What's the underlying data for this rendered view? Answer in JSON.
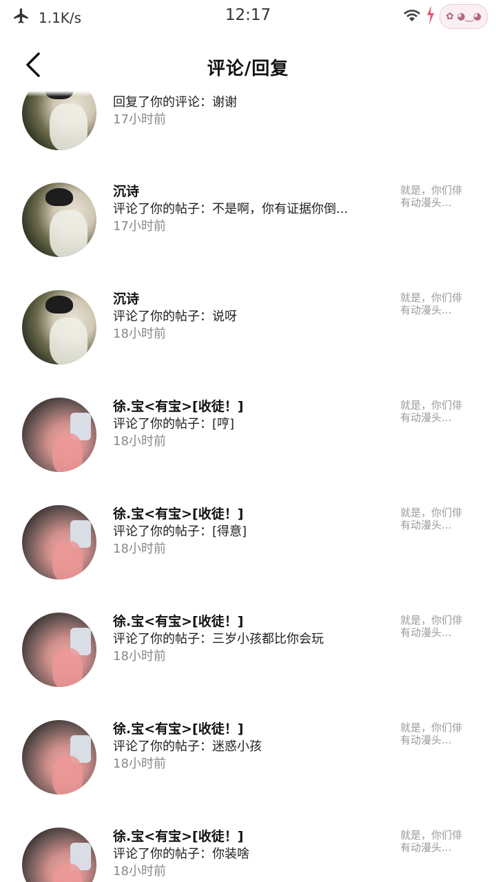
{
  "status_bar": {
    "network_speed": "1.1K/s",
    "time": "12:17"
  },
  "header": {
    "title": "评论/回复"
  },
  "items": [
    {
      "name": "",
      "action": "回复了你的评论：谢谢",
      "time": "17小时前",
      "preview": [
        "",
        ""
      ],
      "avatar": "a"
    },
    {
      "name": "沉诗",
      "action": "评论了你的帖子：不是啊，你有证据你倒...",
      "time": "17小时前",
      "preview": [
        "就是，你们俳",
        "有动漫头..."
      ],
      "avatar": "a"
    },
    {
      "name": "沉诗",
      "action": "评论了你的帖子：说呀",
      "time": "18小时前",
      "preview": [
        "就是，你们俳",
        "有动漫头..."
      ],
      "avatar": "a"
    },
    {
      "name": "徐.宝<有宝>[收徒！]",
      "action": "评论了你的帖子：[哼]",
      "time": "18小时前",
      "preview": [
        "就是，你们俳",
        "有动漫头..."
      ],
      "avatar": "b"
    },
    {
      "name": "徐.宝<有宝>[收徒！]",
      "action": "评论了你的帖子：[得意]",
      "time": "18小时前",
      "preview": [
        "就是，你们俳",
        "有动漫头..."
      ],
      "avatar": "b"
    },
    {
      "name": "徐.宝<有宝>[收徒！]",
      "action": "评论了你的帖子：三岁小孩都比你会玩",
      "time": "18小时前",
      "preview": [
        "就是，你们俳",
        "有动漫头..."
      ],
      "avatar": "b"
    },
    {
      "name": "徐.宝<有宝>[收徒！]",
      "action": "评论了你的帖子：迷惑小孩",
      "time": "18小时前",
      "preview": [
        "就是，你们俳",
        "有动漫头..."
      ],
      "avatar": "b"
    },
    {
      "name": "徐.宝<有宝>[收徒！]",
      "action": "评论了你的帖子：你装啥",
      "time": "18小时前",
      "preview": [
        "就是，你们俳",
        "有动漫头..."
      ],
      "avatar": "b"
    }
  ]
}
